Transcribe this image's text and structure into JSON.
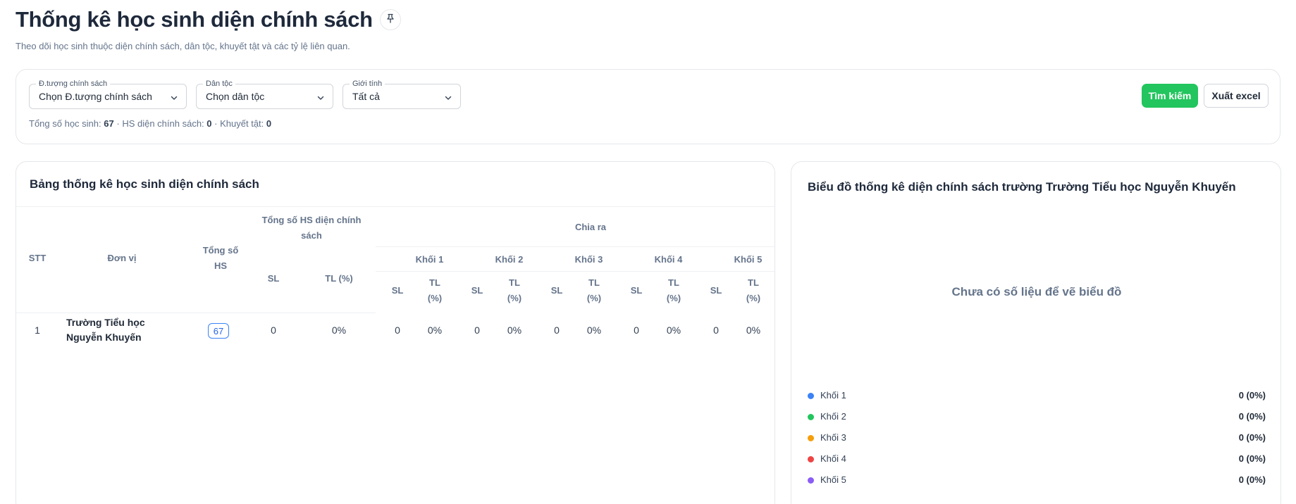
{
  "header": {
    "title": "Thống kê học sinh diện chính sách",
    "subtitle": "Theo dõi học sinh thuộc diện chính sách, dân tộc, khuyết tật và các tỷ lệ liên quan."
  },
  "filters": {
    "policy": {
      "label": "Đ.tượng chính sách",
      "value": "Chọn Đ.tượng chính sách"
    },
    "ethnicity": {
      "label": "Dân tộc",
      "value": "Chọn dân tộc"
    },
    "gender": {
      "label": "Giới tính",
      "value": "Tất cả"
    },
    "search_label": "Tìm kiếm",
    "export_label": "Xuất excel"
  },
  "summary": {
    "total_label": "Tổng số học sinh:",
    "total_value": "67",
    "policy_label": "HS diện chính sách:",
    "policy_value": "0",
    "disabled_label": "Khuyết tật:",
    "disabled_value": "0",
    "sep": "·"
  },
  "table": {
    "title": "Bảng thống kê học sinh diện chính sách",
    "headers": {
      "stt": "STT",
      "unit": "Đơn vị",
      "total": "Tổng số HS",
      "policy_total": "Tổng số HS diện chính sách",
      "breakdown": "Chia ra",
      "sl": "SL",
      "tl": "TL (%)",
      "tl_short": "TL (%)",
      "grades": [
        "Khối 1",
        "Khối 2",
        "Khối 3",
        "Khối 4",
        "Khối 5"
      ]
    },
    "rows": [
      {
        "stt": "1",
        "unit": "Trường Tiểu học Nguyễn Khuyến",
        "total": "67",
        "sl": "0",
        "tl": "0%",
        "grades": [
          {
            "sl": "0",
            "tl": "0%"
          },
          {
            "sl": "0",
            "tl": "0%"
          },
          {
            "sl": "0",
            "tl": "0%"
          },
          {
            "sl": "0",
            "tl": "0%"
          },
          {
            "sl": "0",
            "tl": "0%"
          }
        ]
      }
    ]
  },
  "chart": {
    "title": "Biểu đồ thống kê diện chính sách trường Trường Tiểu học Nguyễn Khuyến",
    "empty_message": "Chưa có số liệu để vẽ biểu đồ",
    "legend": [
      {
        "label": "Khối 1",
        "value": "0 (0%)",
        "color": "#3b82f6"
      },
      {
        "label": "Khối 2",
        "value": "0 (0%)",
        "color": "#22c55e"
      },
      {
        "label": "Khối 3",
        "value": "0 (0%)",
        "color": "#f59e0b"
      },
      {
        "label": "Khối 4",
        "value": "0 (0%)",
        "color": "#ef4444"
      },
      {
        "label": "Khối 5",
        "value": "0 (0%)",
        "color": "#8b5cf6"
      }
    ]
  },
  "icons": {
    "pin": "pin-icon",
    "chevron": "chevron-down-icon"
  }
}
